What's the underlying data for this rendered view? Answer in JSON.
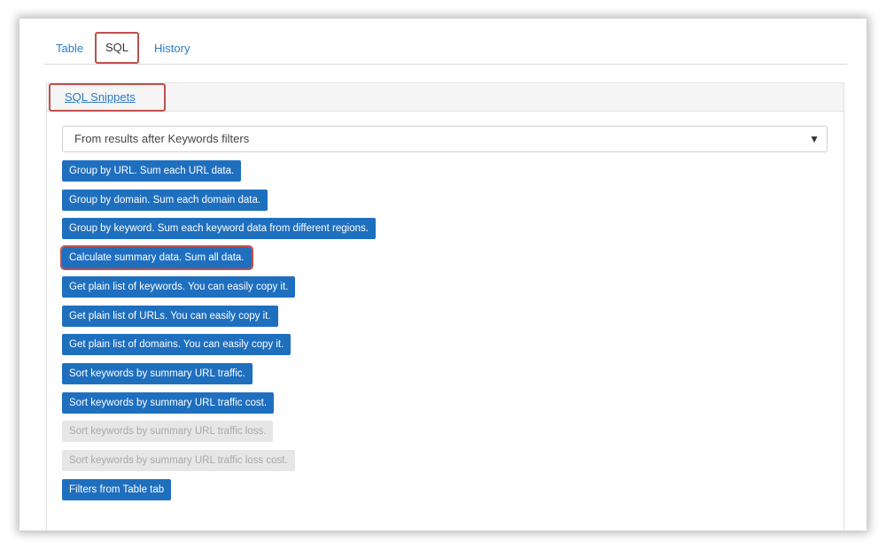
{
  "tabs": {
    "table": "Table",
    "sql": "SQL",
    "history": "History"
  },
  "section": {
    "title": "SQL Snippets"
  },
  "select": {
    "value": "From results after Keywords filters",
    "arrow": "▼"
  },
  "snippets": [
    {
      "label": "Group by URL. Sum each URL data.",
      "enabled": true,
      "highlighted": false
    },
    {
      "label": "Group by domain. Sum each domain data.",
      "enabled": true,
      "highlighted": false
    },
    {
      "label": "Group by keyword. Sum each keyword data from different regions.",
      "enabled": true,
      "highlighted": false
    },
    {
      "label": "Calculate summary data. Sum all data.",
      "enabled": true,
      "highlighted": true
    },
    {
      "label": "Get plain list of keywords. You can easily copy it.",
      "enabled": true,
      "highlighted": false
    },
    {
      "label": "Get plain list of URLs. You can easily copy it.",
      "enabled": true,
      "highlighted": false
    },
    {
      "label": "Get plain list of domains. You can easily copy it.",
      "enabled": true,
      "highlighted": false
    },
    {
      "label": "Sort keywords by summary URL traffic.",
      "enabled": true,
      "highlighted": false
    },
    {
      "label": "Sort keywords by summary URL traffic cost.",
      "enabled": true,
      "highlighted": false
    },
    {
      "label": "Sort keywords by summary URL traffic loss.",
      "enabled": false,
      "highlighted": false
    },
    {
      "label": "Sort keywords by summary URL traffic loss cost.",
      "enabled": false,
      "highlighted": false
    },
    {
      "label": "Filters from Table tab",
      "enabled": true,
      "highlighted": false
    }
  ],
  "colors": {
    "button_primary": "#1f6fbf",
    "button_disabled": "#e6e6e6",
    "link": "#2b7bc4",
    "highlight_border": "#c0504d"
  }
}
